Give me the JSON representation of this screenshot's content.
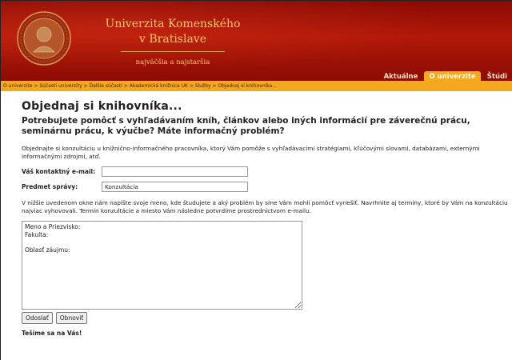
{
  "header": {
    "university_line1": "Univerzita Komenského",
    "university_line2": "v Bratislave",
    "subtitle": "najväčšia a najstaršia",
    "tabs": [
      {
        "label": "Aktuálne",
        "active": false
      },
      {
        "label": "O univerzite",
        "active": true
      },
      {
        "label": "Štúdi",
        "active": false
      }
    ]
  },
  "breadcrumb": "O univerzite > Súčasti univerzity > Ďalšie súčasti > Akademická knižnica UK > Služby > Objednaj si knihovníka...",
  "main": {
    "title": "Objednaj si knihovníka...",
    "lead": "Potrebujete pomôcť s vyhľadávaním kníh, článkov alebo iných informácií pre záverečnú prácu, seminárnu prácu, k výučbe? Máte informačný problém?",
    "intro": "Objednajte si konzultáciu u knižnično-informačného pracovníka, ktorý Vám pomôže s vyhľadávacími stratégiami, kľúčovými slovami, databázami, externými informačnými zdrojmi, atď.",
    "email_label": "Váš kontaktný e-mail:",
    "email_value": "",
    "subject_label": "Predmet správy:",
    "subject_value": "Konzultácia",
    "instructions": "V nižšie uvedenom okne nám napíšte svoje meno, kde študujete a aký problém by sme Vám mohli pomôcť vyriešiť. Navrhnite aj termíny, ktoré by Vám na konzultáciu najviac vyhovovali. Termín konzultácie a miesto Vám následne potvrdíme prostredníctvom e-mailu.",
    "message_value": "Meno a Priezvisko:\nFakulta:\n\nOblasť záujmu:",
    "send_label": "Odoslať",
    "reset_label": "Obnoviť",
    "thanks": "Tešíme sa na Vás!"
  },
  "colors": {
    "header_red": "#a8140a",
    "accent_orange": "#f3a81d",
    "gold_text": "#f5c96b"
  }
}
